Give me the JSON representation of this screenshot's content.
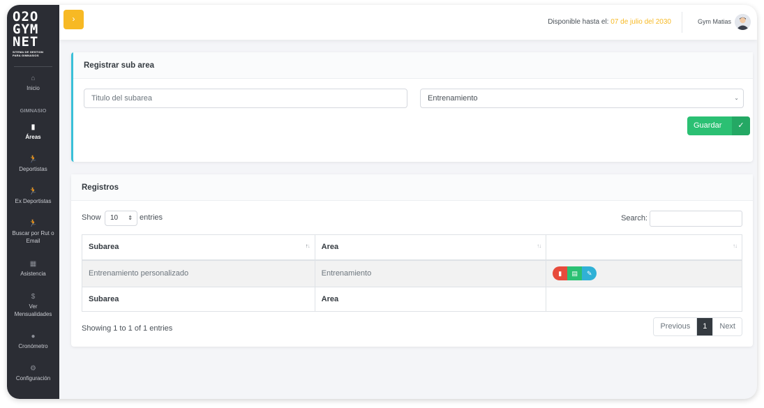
{
  "brand": {
    "logo_line1": "O2O",
    "logo_line2": "GYM",
    "logo_line3": "NET",
    "logo_sub1": "SITEMA DE GESTION",
    "logo_sub2": "PARA GIMNASIOS"
  },
  "sidebar": {
    "section_gym": "GIMNASIO",
    "items": [
      {
        "label": "Inicio",
        "icon": "home-icon",
        "glyph": "⌂"
      },
      {
        "label": "Áreas",
        "icon": "clipboard-icon",
        "glyph": "▮",
        "active": true
      },
      {
        "label": "Deportistas",
        "icon": "running-icon",
        "glyph": "🏃"
      },
      {
        "label": "Ex Deportistas",
        "icon": "running-icon",
        "glyph": "🏃"
      },
      {
        "label": "Buscar por Rut o Email",
        "icon": "running-icon",
        "glyph": "🏃"
      },
      {
        "label": "Asistencia",
        "icon": "calendar-icon",
        "glyph": "▦"
      },
      {
        "label": "Ver Mensualidades",
        "icon": "dollar-icon",
        "glyph": "$"
      },
      {
        "label": "Cronómetro",
        "icon": "stopwatch-icon",
        "glyph": "●"
      },
      {
        "label": "Configuración",
        "icon": "cogs-icon",
        "glyph": "⚙"
      }
    ]
  },
  "header": {
    "toggle_glyph": "›",
    "available_label": "Disponible hasta el:",
    "available_date": "07 de julio del 2030",
    "user_name": "Gym Matias"
  },
  "form": {
    "title": "Registrar sub area",
    "subarea_placeholder": "Titulo del subarea",
    "area_selected": "Entrenamiento",
    "save_label": "Guardar"
  },
  "records": {
    "title": "Registros",
    "show_label": "Show",
    "page_length": "10",
    "entries_label": "entries",
    "search_label": "Search:",
    "columns": [
      "Subarea",
      "Area",
      ""
    ],
    "rows": [
      {
        "subarea": "Entrenamiento personalizado",
        "area": "Entrenamiento"
      }
    ],
    "info": "Showing 1 to 1 of 1 entries",
    "pager": {
      "previous": "Previous",
      "current": "1",
      "next": "Next"
    }
  },
  "colors": {
    "accent_yellow": "#f7b924",
    "sidebar_bg": "#2b2d34",
    "success_green": "#2bc073",
    "danger_red": "#e74b3c",
    "info_cyan": "#30b1d6",
    "card_accent": "#3ac0d8"
  }
}
